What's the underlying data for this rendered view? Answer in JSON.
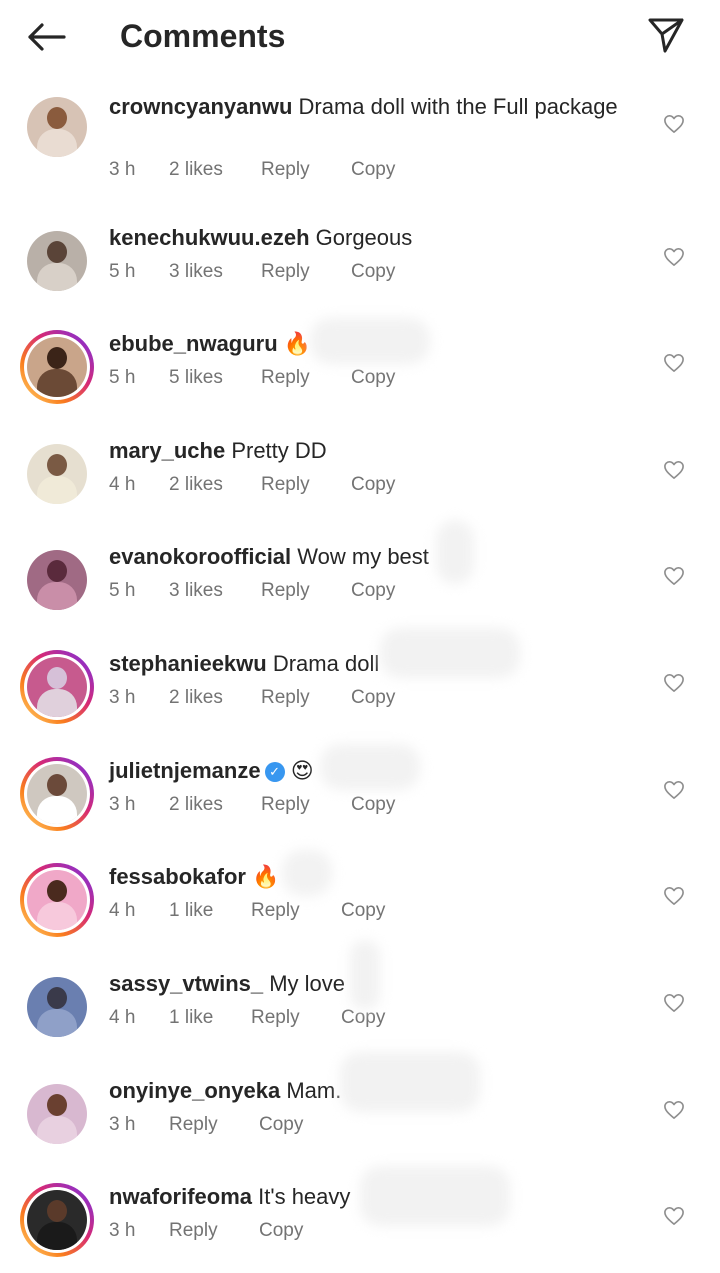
{
  "header": {
    "title": "Comments",
    "back_icon": "arrow-left-icon",
    "share_icon": "paper-plane-icon"
  },
  "colors": {
    "text": "#262626",
    "meta": "#737373",
    "verified": "#3897f0",
    "story_ring": [
      "#feda75",
      "#fa7e1e",
      "#d62976",
      "#962fbf"
    ]
  },
  "comments": [
    {
      "username": "crowncyanyanwu",
      "text": "Drama doll with the Full package",
      "time": "3 h",
      "likes": "2 likes",
      "reply": "Reply",
      "copy": "Copy",
      "ring": false
    },
    {
      "username": "kenechukwuu.ezeh",
      "text": "Gorgeous",
      "time": "5 h",
      "likes": "3 likes",
      "reply": "Reply",
      "copy": "Copy",
      "ring": false
    },
    {
      "username": "ebube_nwaguru",
      "text": "🔥",
      "time": "5 h",
      "likes": "5 likes",
      "reply": "Reply",
      "copy": "Copy",
      "ring": true
    },
    {
      "username": "mary_uche",
      "text": "Pretty DD",
      "time": "4 h",
      "likes": "2 likes",
      "reply": "Reply",
      "copy": "Copy",
      "ring": false
    },
    {
      "username": "evanokoroofficial",
      "text": "Wow my best",
      "time": "5 h",
      "likes": "3 likes",
      "reply": "Reply",
      "copy": "Copy",
      "ring": false
    },
    {
      "username": "stephanieekwu",
      "text": "Drama doll",
      "time": "3 h",
      "likes": "2 likes",
      "reply": "Reply",
      "copy": "Copy",
      "ring": true
    },
    {
      "username": "julietnjemanze",
      "text": "😍",
      "time": "3 h",
      "likes": "2 likes",
      "reply": "Reply",
      "copy": "Copy",
      "ring": true,
      "verified": true
    },
    {
      "username": "fessabokafor",
      "text": "🔥",
      "time": "4 h",
      "likes": "1 like",
      "reply": "Reply",
      "copy": "Copy",
      "ring": true
    },
    {
      "username": "sassy_vtwins_",
      "text": "My love",
      "time": "4 h",
      "likes": "1 like",
      "reply": "Reply",
      "copy": "Copy",
      "ring": false
    },
    {
      "username": "onyinye_onyeka",
      "text": "Mam.",
      "time": "3 h",
      "likes": "",
      "reply": "Reply",
      "copy": "Copy",
      "ring": false
    },
    {
      "username": "nwaforifeoma",
      "text": "It's heavy",
      "time": "3 h",
      "likes": "",
      "reply": "Reply",
      "copy": "Copy",
      "ring": true
    }
  ]
}
